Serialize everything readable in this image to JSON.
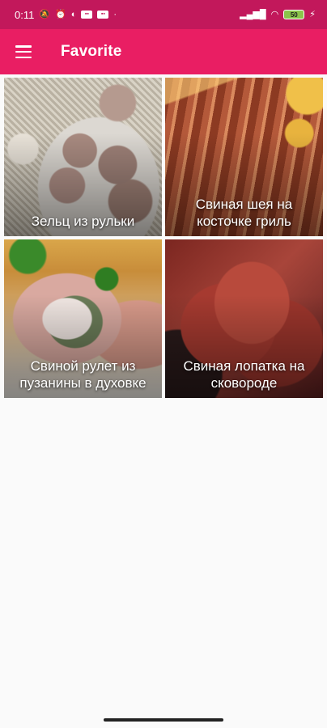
{
  "status_bar": {
    "time": "0:11",
    "battery": "50",
    "left_icons": [
      "mute-icon",
      "alarm-icon",
      "app-icon",
      "notification-icon",
      "notification-icon-2"
    ],
    "right_icons": [
      "signal-icon",
      "wifi-icon",
      "battery-icon",
      "charging-icon"
    ],
    "color": "#c2185b"
  },
  "app_bar": {
    "title": "Favorite",
    "menu_icon": "hamburger-menu-icon",
    "color": "#e91e63"
  },
  "recipes": [
    {
      "title": "Зельц из рульки",
      "image": "aspic-on-plate"
    },
    {
      "title": "Свиная шея на косточке гриль",
      "image": "grilled-pork-neck"
    },
    {
      "title": "Свиной рулет из пузанины в духовке",
      "image": "pork-belly-roll"
    },
    {
      "title": "Свиная лопатка на сковороде",
      "image": "pork-shoulder-pan"
    }
  ]
}
